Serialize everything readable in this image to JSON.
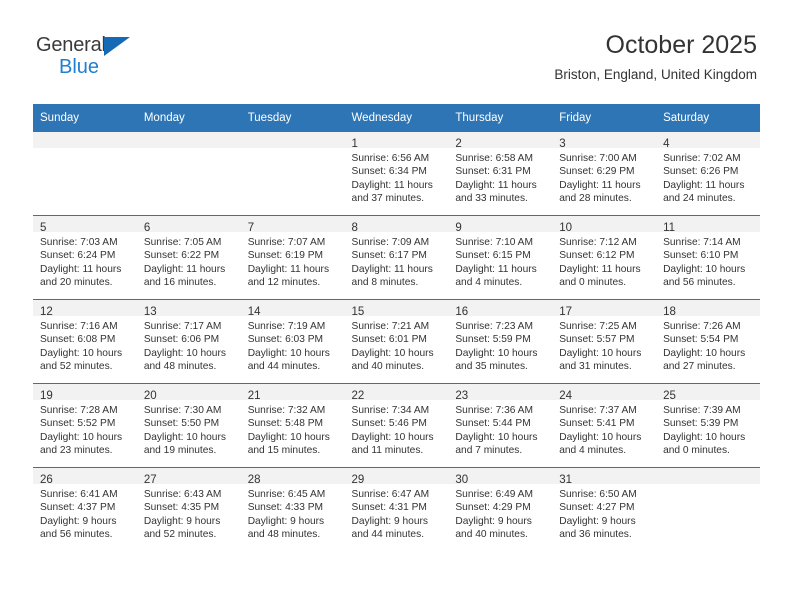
{
  "logo": {
    "word_top": "General",
    "word_bottom": "Blue",
    "triangle_color": "#1669b5",
    "blue_color": "#1f7fd0"
  },
  "header": {
    "month_title": "October 2025",
    "location": "Briston, England, United Kingdom",
    "header_bg": "#2e75b6"
  },
  "weekdays": [
    "Sunday",
    "Monday",
    "Tuesday",
    "Wednesday",
    "Thursday",
    "Friday",
    "Saturday"
  ],
  "weeks": [
    [
      {
        "day": "",
        "lines": []
      },
      {
        "day": "",
        "lines": []
      },
      {
        "day": "",
        "lines": []
      },
      {
        "day": "1",
        "lines": [
          "Sunrise: 6:56 AM",
          "Sunset: 6:34 PM",
          "Daylight: 11 hours",
          "and 37 minutes."
        ]
      },
      {
        "day": "2",
        "lines": [
          "Sunrise: 6:58 AM",
          "Sunset: 6:31 PM",
          "Daylight: 11 hours",
          "and 33 minutes."
        ]
      },
      {
        "day": "3",
        "lines": [
          "Sunrise: 7:00 AM",
          "Sunset: 6:29 PM",
          "Daylight: 11 hours",
          "and 28 minutes."
        ]
      },
      {
        "day": "4",
        "lines": [
          "Sunrise: 7:02 AM",
          "Sunset: 6:26 PM",
          "Daylight: 11 hours",
          "and 24 minutes."
        ]
      }
    ],
    [
      {
        "day": "5",
        "lines": [
          "Sunrise: 7:03 AM",
          "Sunset: 6:24 PM",
          "Daylight: 11 hours",
          "and 20 minutes."
        ]
      },
      {
        "day": "6",
        "lines": [
          "Sunrise: 7:05 AM",
          "Sunset: 6:22 PM",
          "Daylight: 11 hours",
          "and 16 minutes."
        ]
      },
      {
        "day": "7",
        "lines": [
          "Sunrise: 7:07 AM",
          "Sunset: 6:19 PM",
          "Daylight: 11 hours",
          "and 12 minutes."
        ]
      },
      {
        "day": "8",
        "lines": [
          "Sunrise: 7:09 AM",
          "Sunset: 6:17 PM",
          "Daylight: 11 hours",
          "and 8 minutes."
        ]
      },
      {
        "day": "9",
        "lines": [
          "Sunrise: 7:10 AM",
          "Sunset: 6:15 PM",
          "Daylight: 11 hours",
          "and 4 minutes."
        ]
      },
      {
        "day": "10",
        "lines": [
          "Sunrise: 7:12 AM",
          "Sunset: 6:12 PM",
          "Daylight: 11 hours",
          "and 0 minutes."
        ]
      },
      {
        "day": "11",
        "lines": [
          "Sunrise: 7:14 AM",
          "Sunset: 6:10 PM",
          "Daylight: 10 hours",
          "and 56 minutes."
        ]
      }
    ],
    [
      {
        "day": "12",
        "lines": [
          "Sunrise: 7:16 AM",
          "Sunset: 6:08 PM",
          "Daylight: 10 hours",
          "and 52 minutes."
        ]
      },
      {
        "day": "13",
        "lines": [
          "Sunrise: 7:17 AM",
          "Sunset: 6:06 PM",
          "Daylight: 10 hours",
          "and 48 minutes."
        ]
      },
      {
        "day": "14",
        "lines": [
          "Sunrise: 7:19 AM",
          "Sunset: 6:03 PM",
          "Daylight: 10 hours",
          "and 44 minutes."
        ]
      },
      {
        "day": "15",
        "lines": [
          "Sunrise: 7:21 AM",
          "Sunset: 6:01 PM",
          "Daylight: 10 hours",
          "and 40 minutes."
        ]
      },
      {
        "day": "16",
        "lines": [
          "Sunrise: 7:23 AM",
          "Sunset: 5:59 PM",
          "Daylight: 10 hours",
          "and 35 minutes."
        ]
      },
      {
        "day": "17",
        "lines": [
          "Sunrise: 7:25 AM",
          "Sunset: 5:57 PM",
          "Daylight: 10 hours",
          "and 31 minutes."
        ]
      },
      {
        "day": "18",
        "lines": [
          "Sunrise: 7:26 AM",
          "Sunset: 5:54 PM",
          "Daylight: 10 hours",
          "and 27 minutes."
        ]
      }
    ],
    [
      {
        "day": "19",
        "lines": [
          "Sunrise: 7:28 AM",
          "Sunset: 5:52 PM",
          "Daylight: 10 hours",
          "and 23 minutes."
        ]
      },
      {
        "day": "20",
        "lines": [
          "Sunrise: 7:30 AM",
          "Sunset: 5:50 PM",
          "Daylight: 10 hours",
          "and 19 minutes."
        ]
      },
      {
        "day": "21",
        "lines": [
          "Sunrise: 7:32 AM",
          "Sunset: 5:48 PM",
          "Daylight: 10 hours",
          "and 15 minutes."
        ]
      },
      {
        "day": "22",
        "lines": [
          "Sunrise: 7:34 AM",
          "Sunset: 5:46 PM",
          "Daylight: 10 hours",
          "and 11 minutes."
        ]
      },
      {
        "day": "23",
        "lines": [
          "Sunrise: 7:36 AM",
          "Sunset: 5:44 PM",
          "Daylight: 10 hours",
          "and 7 minutes."
        ]
      },
      {
        "day": "24",
        "lines": [
          "Sunrise: 7:37 AM",
          "Sunset: 5:41 PM",
          "Daylight: 10 hours",
          "and 4 minutes."
        ]
      },
      {
        "day": "25",
        "lines": [
          "Sunrise: 7:39 AM",
          "Sunset: 5:39 PM",
          "Daylight: 10 hours",
          "and 0 minutes."
        ]
      }
    ],
    [
      {
        "day": "26",
        "lines": [
          "Sunrise: 6:41 AM",
          "Sunset: 4:37 PM",
          "Daylight: 9 hours",
          "and 56 minutes."
        ]
      },
      {
        "day": "27",
        "lines": [
          "Sunrise: 6:43 AM",
          "Sunset: 4:35 PM",
          "Daylight: 9 hours",
          "and 52 minutes."
        ]
      },
      {
        "day": "28",
        "lines": [
          "Sunrise: 6:45 AM",
          "Sunset: 4:33 PM",
          "Daylight: 9 hours",
          "and 48 minutes."
        ]
      },
      {
        "day": "29",
        "lines": [
          "Sunrise: 6:47 AM",
          "Sunset: 4:31 PM",
          "Daylight: 9 hours",
          "and 44 minutes."
        ]
      },
      {
        "day": "30",
        "lines": [
          "Sunrise: 6:49 AM",
          "Sunset: 4:29 PM",
          "Daylight: 9 hours",
          "and 40 minutes."
        ]
      },
      {
        "day": "31",
        "lines": [
          "Sunrise: 6:50 AM",
          "Sunset: 4:27 PM",
          "Daylight: 9 hours",
          "and 36 minutes."
        ]
      },
      {
        "day": "",
        "lines": []
      }
    ]
  ]
}
